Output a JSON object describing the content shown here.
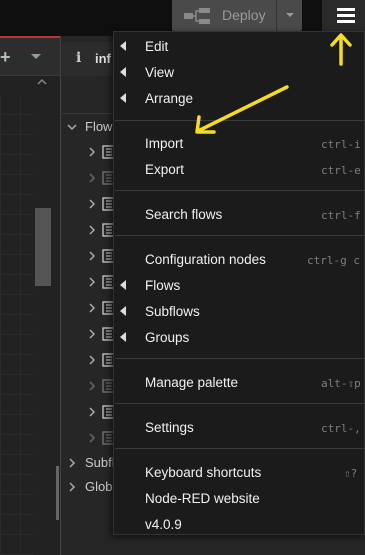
{
  "header": {
    "deploy_label": "Deploy"
  },
  "workspace": {
    "add_flow_label": "+"
  },
  "sidebar": {
    "tab_label": "inf",
    "tree": {
      "flows_label": "Flow",
      "subflows_label": "Subfl",
      "global_label": "Glob"
    }
  },
  "menu": {
    "items": [
      {
        "label": "Edit",
        "submenu": true,
        "shortcut": ""
      },
      {
        "label": "View",
        "submenu": true,
        "shortcut": ""
      },
      {
        "label": "Arrange",
        "submenu": true,
        "shortcut": ""
      },
      {
        "label": "Import",
        "submenu": false,
        "shortcut": "ctrl-i"
      },
      {
        "label": "Export",
        "submenu": false,
        "shortcut": "ctrl-e"
      },
      {
        "label": "Search flows",
        "submenu": false,
        "shortcut": "ctrl-f"
      },
      {
        "label": "Configuration nodes",
        "submenu": false,
        "shortcut": "ctrl-g c"
      },
      {
        "label": "Flows",
        "submenu": true,
        "shortcut": ""
      },
      {
        "label": "Subflows",
        "submenu": true,
        "shortcut": ""
      },
      {
        "label": "Groups",
        "submenu": true,
        "shortcut": ""
      },
      {
        "label": "Manage palette",
        "submenu": false,
        "shortcut": "alt-⇧p"
      },
      {
        "label": "Settings",
        "submenu": false,
        "shortcut": "ctrl-,"
      },
      {
        "label": "Keyboard shortcuts",
        "submenu": false,
        "shortcut": "⇧?"
      },
      {
        "label": "Node-RED website",
        "submenu": false,
        "shortcut": ""
      },
      {
        "label": "v4.0.9",
        "submenu": false,
        "shortcut": ""
      }
    ]
  },
  "colors": {
    "annotation": "#f5dc24",
    "menu_bg": "#1b1b1b",
    "workspace_accent": "#b33333"
  },
  "icons": {
    "deploy": "deploy-icon",
    "menu": "hamburger-menu-icon",
    "flow": "flow-tab-icon"
  }
}
